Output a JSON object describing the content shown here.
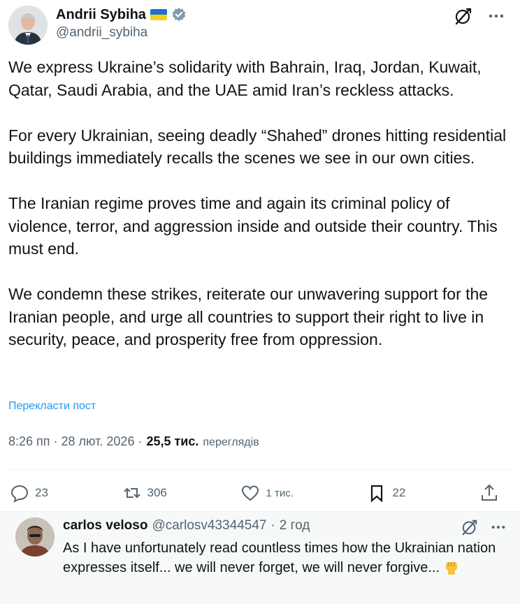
{
  "tweet": {
    "author_name": "Andrii Sybiha",
    "author_handle": "@andrii_sybiha",
    "paragraphs": [
      "We express Ukraine’s solidarity with Bahrain, Iraq, Jordan, Kuwait, Qatar, Saudi Arabia, and the UAE amid Iran’s reckless attacks.",
      "For every Ukrainian, seeing deadly “Shahed” drones hitting residential buildings immediately recalls the scenes we see in our own cities.",
      "The Iranian regime proves time and again its criminal policy of violence, terror, and aggression inside and outside their country. This must end.",
      "We condemn these strikes, reiterate our unwavering support for the Iranian people, and urge all countries to support their right to live in security, peace, and prosperity free from oppression."
    ],
    "translate_label": "Перекласти пост",
    "timestamp": "8:26 пп · 28 лют. 2026 ·",
    "views_count": "25,5 тис.",
    "views_label": "переглядів",
    "stats": {
      "replies": "23",
      "reposts": "306",
      "likes": "1 тис.",
      "bookmarks": "22"
    }
  },
  "reply": {
    "author_name": "carlos veloso",
    "author_handle": "@carlosv43344547",
    "separator": "·",
    "time": "2 год",
    "text": "As I have unfortunately read countless times how the Ukrainian nation expresses itself... we will never forget, we will never forgive..."
  },
  "colors": {
    "text_primary": "#0f1419",
    "text_secondary": "#536471",
    "link": "#1d9bf0",
    "verified": "#829aab",
    "reply_background": "#f7f9f9"
  },
  "icons": [
    "grok-icon",
    "more-icon",
    "verified-icon",
    "ukraine-flag-icon",
    "reply-icon",
    "repost-icon",
    "like-icon",
    "bookmark-icon",
    "share-icon",
    "raised-fist-emoji"
  ]
}
